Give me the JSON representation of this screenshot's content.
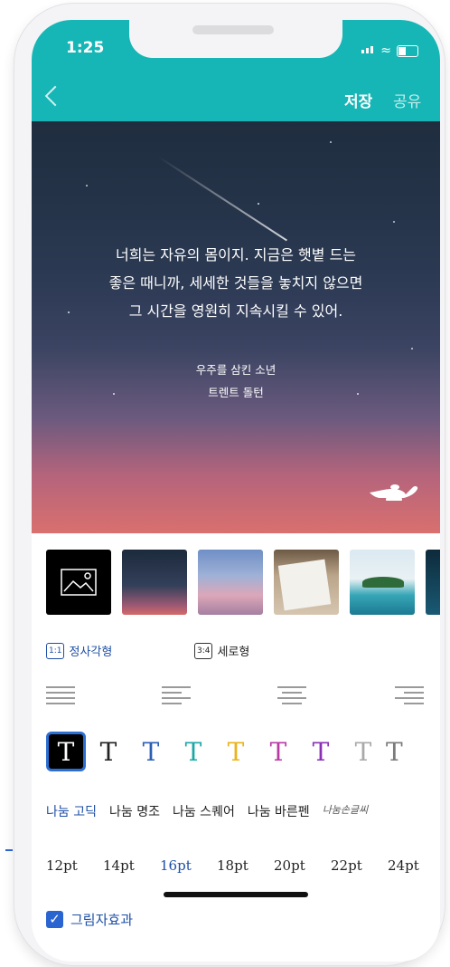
{
  "status_bar": {
    "time": "1:25"
  },
  "header": {
    "save_label": "저장",
    "share_label": "공유"
  },
  "preview": {
    "quote_lines": [
      "너희는 자유의 몸이지. 지금은 햇볕 드는",
      "좋은 때니까, 세세한 것들을 놓치지 않으면",
      "그 시간을 영원히 지속시킬 수 있어."
    ],
    "book_title": "우주를 삼킨 소년",
    "author": "트렌트 돌턴"
  },
  "ratio_options": [
    {
      "badge": "1:1",
      "label": "정사각형"
    },
    {
      "badge": "3:4",
      "label": "세로형"
    }
  ],
  "text_colors": [
    "#ffffff",
    "#222222",
    "#2a5fb4",
    "#1aa7a7",
    "#e9b31a",
    "#b93aa4",
    "#8b2fb5",
    "#a9a9a9",
    "#7a7a7a"
  ],
  "fonts": [
    "나눔 고딕",
    "나눔 명조",
    "나눔 스퀘어",
    "나눔 바른펜",
    "나눔손글씨"
  ],
  "sizes": [
    "12pt",
    "14pt",
    "16pt",
    "18pt",
    "20pt",
    "22pt",
    "24pt"
  ],
  "shadow": {
    "label": "그림자효과",
    "checked": true
  },
  "colors": {
    "header_bg": "#16b6b6",
    "accent": "#1d4fa6"
  }
}
